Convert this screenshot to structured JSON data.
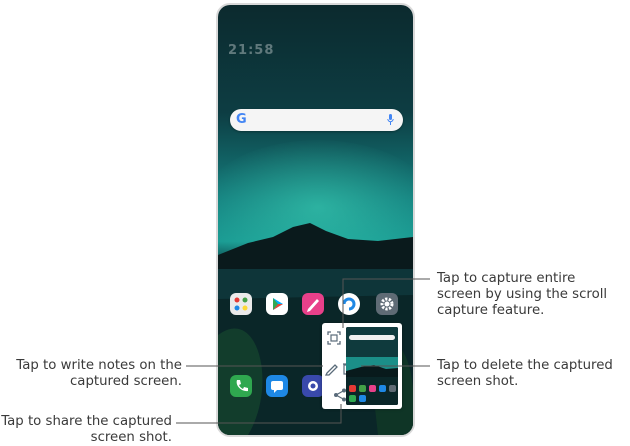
{
  "phone": {
    "clock": "21:58",
    "search": {
      "logo": "G",
      "mic_icon": "mic-icon"
    },
    "apps_row1": [
      "folder-icon",
      "play-store-icon",
      "pen-icon",
      "app-icon",
      "settings-icon"
    ],
    "apps_row2": [
      "phone-icon",
      "messages-icon",
      "camera-icon"
    ],
    "popup": {
      "buttons": [
        "capture-scroll-icon",
        "write-notes-icon",
        "delete-icon",
        "share-icon"
      ]
    }
  },
  "annotations": {
    "capture": [
      "Tap to capture entire",
      "screen by using the scroll",
      "capture feature."
    ],
    "write": [
      "Tap to write notes on the",
      "captured screen."
    ],
    "delete": [
      "Tap to delete the captured",
      "screen shot."
    ],
    "share": [
      "Tap to share the captured",
      "screen shot."
    ]
  },
  "colors": {
    "popup_icon": "#5a6b7a",
    "leader_line": "#555555",
    "phone_icon": "#2fa84f",
    "messages_icon": "#1e88e5",
    "playstore_bg": "#ffffff",
    "pen_bg": "#e8408a"
  }
}
